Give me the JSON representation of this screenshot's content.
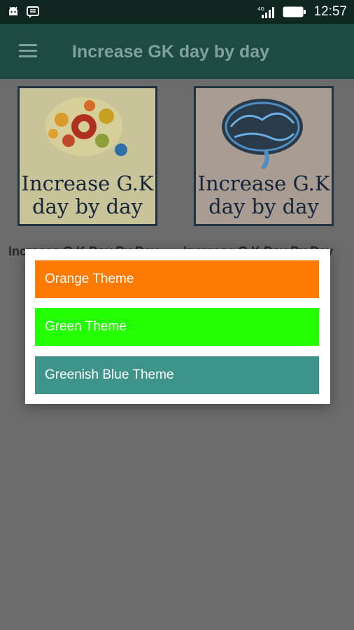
{
  "status_bar": {
    "time": "12:57",
    "network": "4G",
    "icons": [
      "android-icon",
      "message-icon",
      "signal-icon",
      "battery-icon"
    ]
  },
  "app_bar": {
    "title": "Increase GK day by day",
    "menu_icon": "hamburger-menu-icon"
  },
  "cards": [
    {
      "image_text_line1": "Increase G.K",
      "image_text_line2": "day by day",
      "caption": "Increase G.K Day By Day",
      "art": "gears-brain"
    },
    {
      "image_text_line1": "Increase G.K",
      "image_text_line2": "day by day",
      "caption": "Increase G.K Day By Day",
      "art": "blue-brain"
    }
  ],
  "theme_dialog": {
    "options": [
      {
        "label": "Orange Theme",
        "color": "#ff7a00"
      },
      {
        "label": "Green Theme",
        "color": "#22ff00"
      },
      {
        "label": "Greenish Blue Theme",
        "color": "#3e948a"
      }
    ]
  }
}
